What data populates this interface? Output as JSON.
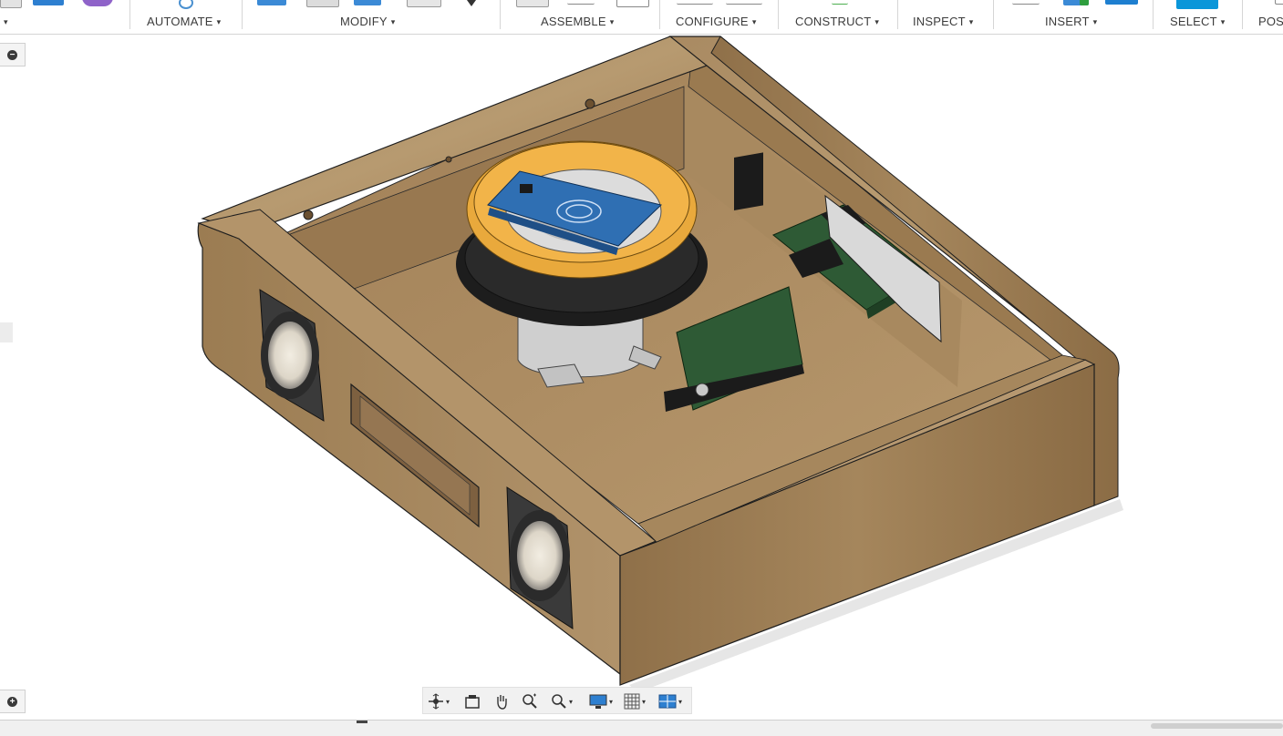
{
  "toolbar": {
    "groups": [
      {
        "label": "",
        "id": "create"
      },
      {
        "label": "AUTOMATE",
        "id": "automate"
      },
      {
        "label": "MODIFY",
        "id": "modify"
      },
      {
        "label": "ASSEMBLE",
        "id": "assemble"
      },
      {
        "label": "CONFIGURE",
        "id": "configure"
      },
      {
        "label": "CONSTRUCT",
        "id": "construct"
      },
      {
        "label": "INSPECT",
        "id": "inspect"
      },
      {
        "label": "INSERT",
        "id": "insert"
      },
      {
        "label": "SELECT",
        "id": "select"
      },
      {
        "label": "POS",
        "id": "position"
      }
    ],
    "caret": "▾"
  },
  "viewport": {
    "model": "wooden speaker enclosure with turntable, RFID board and circuit boards",
    "collapse_button_symbol": "−",
    "expand_button_symbol": "+"
  },
  "navbar": {
    "tools": [
      "orbit-icon",
      "look-at-icon",
      "pan-icon",
      "zoom-icon",
      "fit-icon",
      "display-settings-icon",
      "grid-icon",
      "viewports-icon"
    ],
    "caret": "▾"
  },
  "colors": {
    "wood_light": "#b89668",
    "wood_dark": "#8a6a42",
    "gear_yellow": "#e9a93c",
    "board_blue": "#2f6fb3",
    "pcb_green": "#2e5a35",
    "select_blue": "#0a96d9"
  }
}
